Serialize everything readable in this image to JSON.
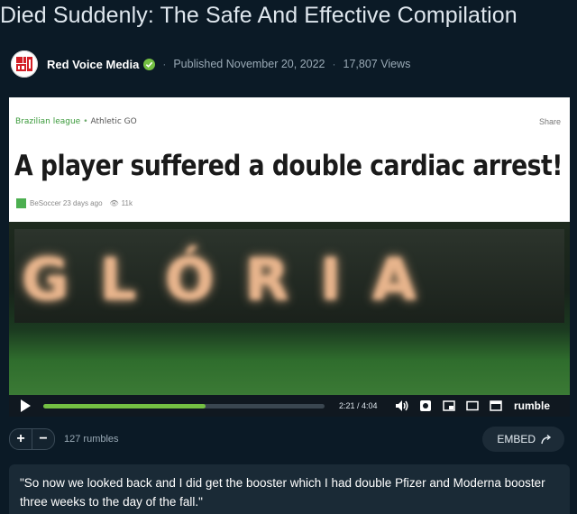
{
  "video": {
    "title": "Died Suddenly: The Safe And Effective Compilation"
  },
  "channel": {
    "name": "Red Voice Media",
    "verified_icon": "check-circle-icon",
    "published": "Published November 20, 2022",
    "views": "17,807 Views",
    "accent_color": "#74c043"
  },
  "frame": {
    "breadcrumb_primary": "Brazilian league",
    "breadcrumb_secondary": "Athletic GO",
    "share_label": "Share",
    "headline": "A player suffered a double cardiac arrest!",
    "byline_source": "BeSoccer",
    "byline_age": "23 days ago",
    "byline_views": "11k",
    "stadium_text": "GLÓRIA"
  },
  "player": {
    "time": "2:21 / 4:04",
    "progress": 0.577,
    "brand": "rumble"
  },
  "actions": {
    "upvote": "+",
    "downvote": "−",
    "rumbles": "127 rumbles",
    "embed_label": "EMBED"
  },
  "description": {
    "text": "\"So now we looked back and I did get the booster which I had double Pfizer and Moderna booster three weeks to the day of the fall.\""
  }
}
